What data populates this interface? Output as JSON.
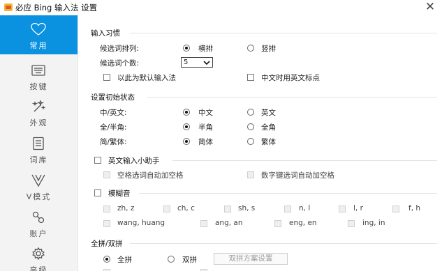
{
  "window": {
    "title": "必应 Bing 输入法 设置",
    "close_symbol": "✕"
  },
  "sidebar": {
    "items": [
      {
        "label": "常用",
        "icon": "heart-icon",
        "active": true
      },
      {
        "label": "按键",
        "icon": "keyboard-icon",
        "active": false
      },
      {
        "label": "外观",
        "icon": "magic-wand-icon",
        "active": false
      },
      {
        "label": "词库",
        "icon": "document-icon",
        "active": false
      },
      {
        "label": "V模式",
        "icon": "v-mode-icon",
        "active": false
      },
      {
        "label": "账户",
        "icon": "account-icon",
        "active": false
      },
      {
        "label": "高级",
        "icon": "gear-icon",
        "active": false
      }
    ],
    "active_color": "#0a92e0"
  },
  "input_habits": {
    "section_title": "输入习惯",
    "candidate_order_label": "候选词排列:",
    "horizontal_label": "横排",
    "vertical_label": "竖排",
    "candidate_count_label": "候选词个数:",
    "candidate_count_value": "5",
    "default_ime_label": "以此为默认输入法",
    "english_punct_label": "中文时用英文标点"
  },
  "initial_state": {
    "section_title": "设置初始状态",
    "rows": [
      {
        "label": "中/英文:",
        "opt1": "中文",
        "opt2": "英文"
      },
      {
        "label": "全/半角:",
        "opt1": "半角",
        "opt2": "全角"
      },
      {
        "label": "简/繁体:",
        "opt1": "简体",
        "opt2": "繁体"
      }
    ]
  },
  "english_helper": {
    "section_title": "英文输入小助手",
    "space_option": "空格选词自动加空格",
    "number_option": "数字键选词自动加空格"
  },
  "fuzzy": {
    "section_title": "模糊音",
    "row1": [
      "zh, z",
      "ch, c",
      "sh, s",
      "n, l",
      "l, r",
      "f, h"
    ],
    "row2": [
      "wang, huang",
      "ang, an",
      "eng, en",
      "ing, in"
    ]
  },
  "pinyin_mode": {
    "section_title": "全拼/双拼",
    "full_label": "全拼",
    "double_label": "双拼",
    "scheme_button": "双拼方案设置"
  }
}
